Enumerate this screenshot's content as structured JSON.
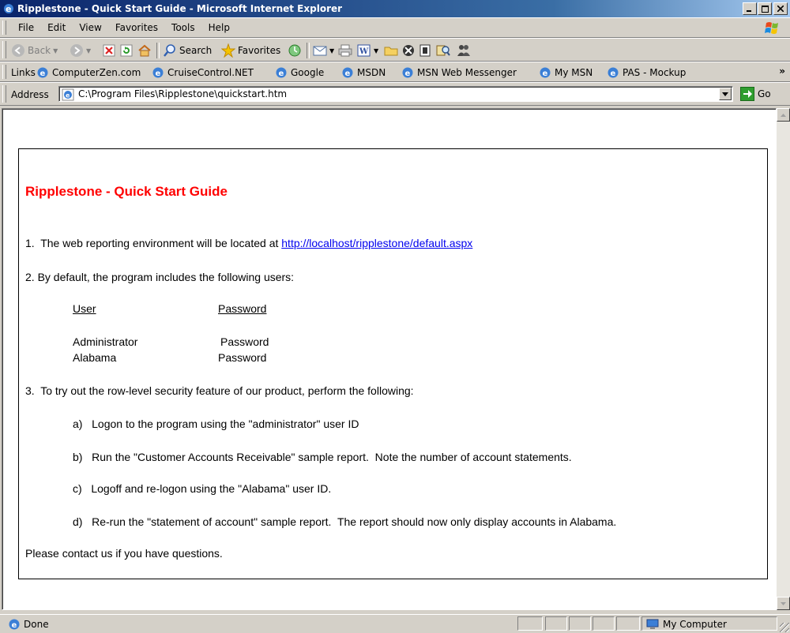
{
  "window": {
    "title": "Ripplestone - Quick Start Guide - Microsoft Internet Explorer"
  },
  "menu": [
    "File",
    "Edit",
    "View",
    "Favorites",
    "Tools",
    "Help"
  ],
  "toolbar": {
    "back": "Back",
    "search": "Search",
    "favorites": "Favorites"
  },
  "links": {
    "label": "Links",
    "items": [
      "ComputerZen.com",
      "CruiseControl.NET",
      "Google",
      "MSDN",
      "MSN Web Messenger",
      "My MSN",
      "PAS - Mockup"
    ],
    "overflow": "»"
  },
  "address": {
    "label": "Address",
    "value": "C:\\Program Files\\Ripplestone\\quickstart.htm",
    "go": "Go"
  },
  "doc": {
    "title": "Ripplestone - Quick Start Guide",
    "item1_prefix": "1.  The web reporting environment will be located at ",
    "item1_link": "http://localhost/ripplestone/default.aspx",
    "item2": "2.  By default, the program includes the following users:",
    "col_user": "User",
    "col_password": "Password",
    "users": [
      {
        "user": "Administrator",
        "password": "Password"
      },
      {
        "user": "Alabama",
        "password": "Password"
      }
    ],
    "item3": "3.  To try out the row-level security feature of our product, perform the following:",
    "steps": [
      "a)   Logon to the program using the \"administrator\" user ID",
      "b)   Run the \"Customer Accounts Receivable\" sample report.  Note the number of account statements.",
      "c)   Logoff and re-logon using the \"Alabama\" user ID.",
      "d)   Re-run the \"statement of account\" sample report.  The report should now only display accounts in Alabama."
    ],
    "closing": "Please contact us if you have questions."
  },
  "status": {
    "text": "Done",
    "zone": "My Computer"
  }
}
